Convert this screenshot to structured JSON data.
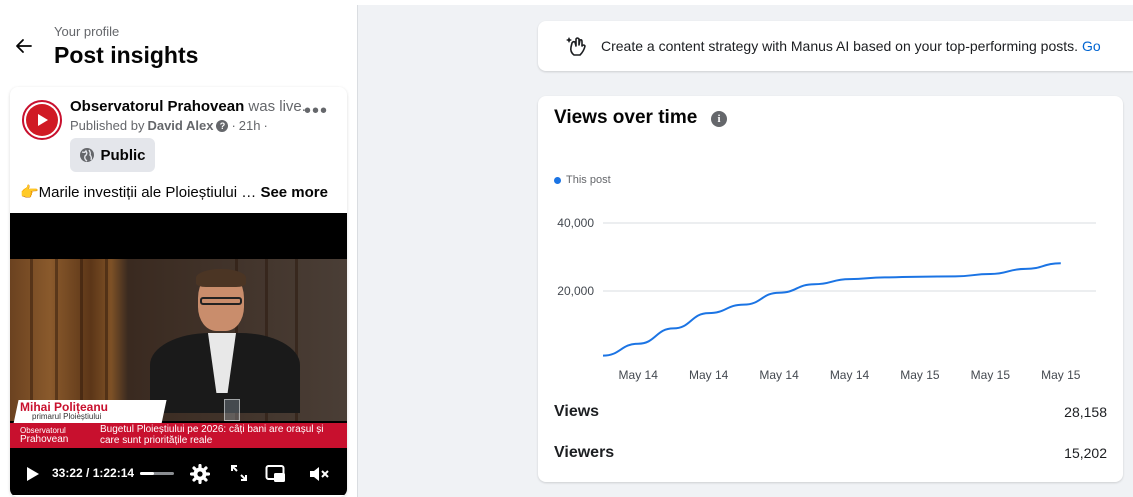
{
  "header": {
    "subtitle": "Your profile",
    "title": "Post insights"
  },
  "post": {
    "page_name": "Observatorul Prahovean",
    "action": "was live.",
    "published_by_label": "Published by",
    "published_by_name": "David Alex",
    "age": "21h",
    "privacy": "Public",
    "text": "👉Marile investiții ale Ploieștiului",
    "see_more": "See more"
  },
  "video": {
    "lower_third_name": "Mihai Polițeanu",
    "lower_third_role": "primarul Ploieștiului",
    "logo_line1": "Observatorul",
    "logo_line2": "Prahovean",
    "headline": "Bugetul Ploieștiului pe 2026: câți bani are orașul și care sunt prioritățile reale",
    "time": "33:22 / 1:22:14",
    "progress_fraction": 0.4,
    "icons": [
      "play-icon",
      "settings-icon",
      "fullscreen-icon",
      "miniplayer-icon",
      "mute-icon"
    ]
  },
  "banner": {
    "text": "Create a content strategy with Manus AI based on your top-performing posts.",
    "link": "Go"
  },
  "chart_data": {
    "type": "line",
    "title": "Views over time",
    "xlabel": "",
    "ylabel": "",
    "legend": "top-left",
    "grid": true,
    "ylim": [
      0,
      45000
    ],
    "y_ticks": [
      20000,
      40000
    ],
    "y_tick_labels": [
      "20,000",
      "40,000"
    ],
    "categories": [
      "May 14",
      "May 14",
      "May 14",
      "May 14",
      "May 15",
      "May 15",
      "May 15"
    ],
    "series": [
      {
        "name": "This post",
        "color": "#1b74e4",
        "x": [
          0,
          0.5,
          1,
          1.5,
          2,
          2.5,
          3,
          3.5,
          4,
          4.5,
          5,
          5.5,
          6,
          6.5
        ],
        "values": [
          1000,
          4500,
          9000,
          13500,
          16000,
          19500,
          22000,
          23500,
          24000,
          24200,
          24300,
          25000,
          26500,
          28158
        ]
      }
    ]
  },
  "stats": [
    {
      "label": "Views",
      "value": "28,158"
    },
    {
      "label": "Viewers",
      "value": "15,202"
    }
  ]
}
